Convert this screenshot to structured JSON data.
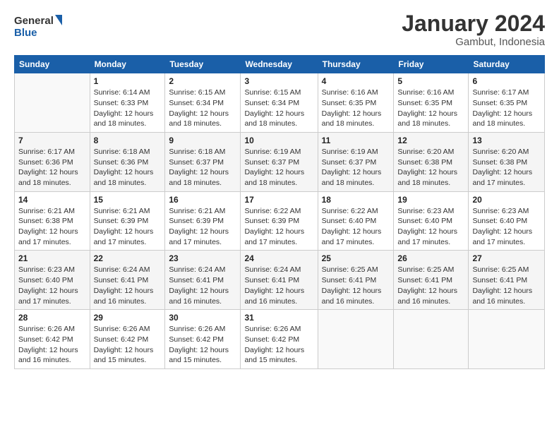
{
  "logo": {
    "line1": "General",
    "line2": "Blue"
  },
  "title": "January 2024",
  "subtitle": "Gambut, Indonesia",
  "days_of_week": [
    "Sunday",
    "Monday",
    "Tuesday",
    "Wednesday",
    "Thursday",
    "Friday",
    "Saturday"
  ],
  "weeks": [
    {
      "shade": false,
      "days": [
        {
          "num": "",
          "info": ""
        },
        {
          "num": "1",
          "info": "Sunrise: 6:14 AM\nSunset: 6:33 PM\nDaylight: 12 hours\nand 18 minutes."
        },
        {
          "num": "2",
          "info": "Sunrise: 6:15 AM\nSunset: 6:34 PM\nDaylight: 12 hours\nand 18 minutes."
        },
        {
          "num": "3",
          "info": "Sunrise: 6:15 AM\nSunset: 6:34 PM\nDaylight: 12 hours\nand 18 minutes."
        },
        {
          "num": "4",
          "info": "Sunrise: 6:16 AM\nSunset: 6:35 PM\nDaylight: 12 hours\nand 18 minutes."
        },
        {
          "num": "5",
          "info": "Sunrise: 6:16 AM\nSunset: 6:35 PM\nDaylight: 12 hours\nand 18 minutes."
        },
        {
          "num": "6",
          "info": "Sunrise: 6:17 AM\nSunset: 6:35 PM\nDaylight: 12 hours\nand 18 minutes."
        }
      ]
    },
    {
      "shade": true,
      "days": [
        {
          "num": "7",
          "info": "Sunrise: 6:17 AM\nSunset: 6:36 PM\nDaylight: 12 hours\nand 18 minutes."
        },
        {
          "num": "8",
          "info": "Sunrise: 6:18 AM\nSunset: 6:36 PM\nDaylight: 12 hours\nand 18 minutes."
        },
        {
          "num": "9",
          "info": "Sunrise: 6:18 AM\nSunset: 6:37 PM\nDaylight: 12 hours\nand 18 minutes."
        },
        {
          "num": "10",
          "info": "Sunrise: 6:19 AM\nSunset: 6:37 PM\nDaylight: 12 hours\nand 18 minutes."
        },
        {
          "num": "11",
          "info": "Sunrise: 6:19 AM\nSunset: 6:37 PM\nDaylight: 12 hours\nand 18 minutes."
        },
        {
          "num": "12",
          "info": "Sunrise: 6:20 AM\nSunset: 6:38 PM\nDaylight: 12 hours\nand 18 minutes."
        },
        {
          "num": "13",
          "info": "Sunrise: 6:20 AM\nSunset: 6:38 PM\nDaylight: 12 hours\nand 17 minutes."
        }
      ]
    },
    {
      "shade": false,
      "days": [
        {
          "num": "14",
          "info": "Sunrise: 6:21 AM\nSunset: 6:38 PM\nDaylight: 12 hours\nand 17 minutes."
        },
        {
          "num": "15",
          "info": "Sunrise: 6:21 AM\nSunset: 6:39 PM\nDaylight: 12 hours\nand 17 minutes."
        },
        {
          "num": "16",
          "info": "Sunrise: 6:21 AM\nSunset: 6:39 PM\nDaylight: 12 hours\nand 17 minutes."
        },
        {
          "num": "17",
          "info": "Sunrise: 6:22 AM\nSunset: 6:39 PM\nDaylight: 12 hours\nand 17 minutes."
        },
        {
          "num": "18",
          "info": "Sunrise: 6:22 AM\nSunset: 6:40 PM\nDaylight: 12 hours\nand 17 minutes."
        },
        {
          "num": "19",
          "info": "Sunrise: 6:23 AM\nSunset: 6:40 PM\nDaylight: 12 hours\nand 17 minutes."
        },
        {
          "num": "20",
          "info": "Sunrise: 6:23 AM\nSunset: 6:40 PM\nDaylight: 12 hours\nand 17 minutes."
        }
      ]
    },
    {
      "shade": true,
      "days": [
        {
          "num": "21",
          "info": "Sunrise: 6:23 AM\nSunset: 6:40 PM\nDaylight: 12 hours\nand 17 minutes."
        },
        {
          "num": "22",
          "info": "Sunrise: 6:24 AM\nSunset: 6:41 PM\nDaylight: 12 hours\nand 16 minutes."
        },
        {
          "num": "23",
          "info": "Sunrise: 6:24 AM\nSunset: 6:41 PM\nDaylight: 12 hours\nand 16 minutes."
        },
        {
          "num": "24",
          "info": "Sunrise: 6:24 AM\nSunset: 6:41 PM\nDaylight: 12 hours\nand 16 minutes."
        },
        {
          "num": "25",
          "info": "Sunrise: 6:25 AM\nSunset: 6:41 PM\nDaylight: 12 hours\nand 16 minutes."
        },
        {
          "num": "26",
          "info": "Sunrise: 6:25 AM\nSunset: 6:41 PM\nDaylight: 12 hours\nand 16 minutes."
        },
        {
          "num": "27",
          "info": "Sunrise: 6:25 AM\nSunset: 6:41 PM\nDaylight: 12 hours\nand 16 minutes."
        }
      ]
    },
    {
      "shade": false,
      "days": [
        {
          "num": "28",
          "info": "Sunrise: 6:26 AM\nSunset: 6:42 PM\nDaylight: 12 hours\nand 16 minutes."
        },
        {
          "num": "29",
          "info": "Sunrise: 6:26 AM\nSunset: 6:42 PM\nDaylight: 12 hours\nand 15 minutes."
        },
        {
          "num": "30",
          "info": "Sunrise: 6:26 AM\nSunset: 6:42 PM\nDaylight: 12 hours\nand 15 minutes."
        },
        {
          "num": "31",
          "info": "Sunrise: 6:26 AM\nSunset: 6:42 PM\nDaylight: 12 hours\nand 15 minutes."
        },
        {
          "num": "",
          "info": ""
        },
        {
          "num": "",
          "info": ""
        },
        {
          "num": "",
          "info": ""
        }
      ]
    }
  ]
}
